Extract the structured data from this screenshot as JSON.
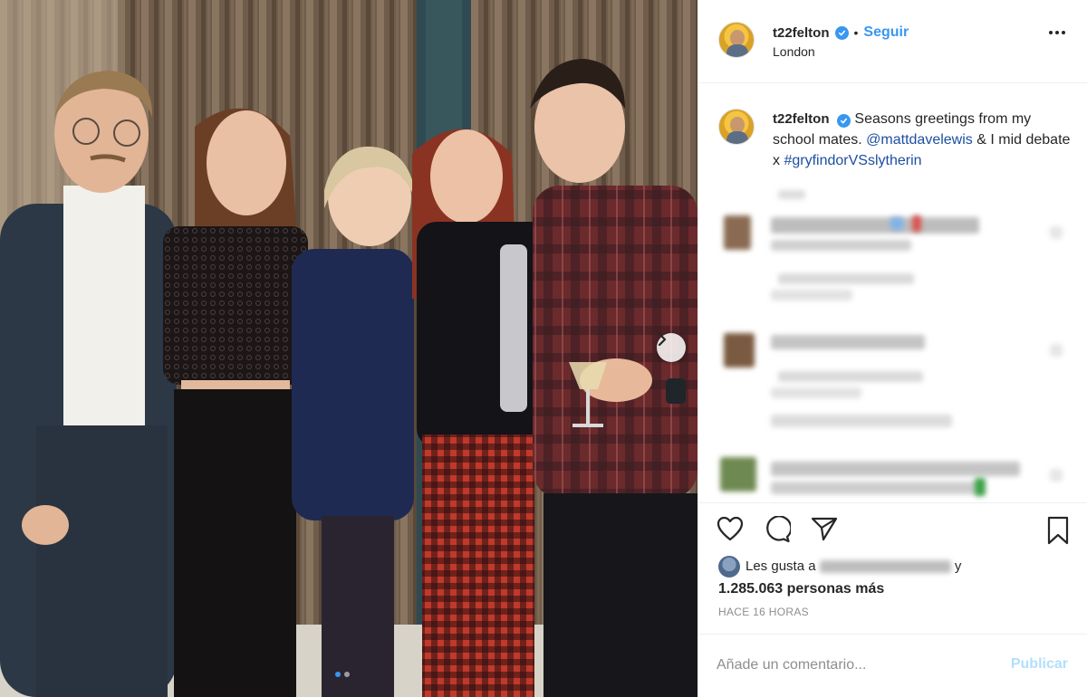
{
  "header": {
    "username": "t22felton",
    "follow_label": "Seguir",
    "separator": "•",
    "location": "London",
    "more_icon": "more-dots-icon"
  },
  "caption": {
    "username": "t22felton",
    "text_1": "Seasons greetings from my school mates.",
    "mention": "@mattdavelewis",
    "text_2": "& I mid debate x",
    "hashtag": "#gryfindorVSslytherin"
  },
  "colors": {
    "accent": "#3897f0",
    "link": "#1d4fa0",
    "muted": "#8e8e8e",
    "post_disabled": "#b2dffc"
  },
  "likes": {
    "prefix": "Les gusta a",
    "suffix": "y",
    "count_line": "1.285.063 personas más"
  },
  "timestamp": "HACE 16 HORAS",
  "comment": {
    "placeholder": "Añade un comentario...",
    "post_label": "Publicar"
  },
  "icons": {
    "like": "heart-icon",
    "comment": "comment-icon",
    "share": "share-icon",
    "save": "bookmark-icon",
    "next": "chevron-right-icon"
  },
  "carousel": {
    "slide_count": 2,
    "current_slide": 1
  }
}
